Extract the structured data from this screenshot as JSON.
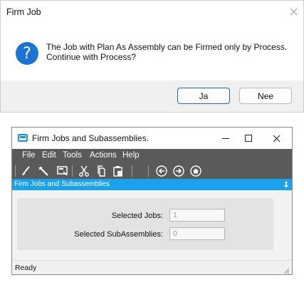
{
  "dialog": {
    "title": "Firm Job",
    "message_line1": "The Job with Plan As Assembly can be Firmed only by Process.",
    "message_line2": "Continue with Process?",
    "buttons": {
      "yes": "Ja",
      "no": "Nee"
    },
    "icon": "question-icon"
  },
  "window": {
    "title": "Firm Jobs and Subassemblies.",
    "menu": [
      "File",
      "Edit",
      "Tools",
      "Actions",
      "Help"
    ],
    "toolbar_icons": [
      "brush-icon",
      "magic-wand-icon",
      "screen-edit-icon",
      "cut-icon",
      "copy-icon",
      "paste-icon",
      "back-icon",
      "forward-icon",
      "home-icon"
    ],
    "panel_title": "Firm Jobs and Subassemblies",
    "form": {
      "selected_jobs_label": "Selected Jobs:",
      "selected_jobs_value": "1",
      "selected_subassemblies_label": "Selected SubAssemblies:",
      "selected_subassemblies_value": "0"
    },
    "status": "Ready"
  },
  "colors": {
    "accent": "#1aa2ec",
    "menubar": "#5a5a5a",
    "dialog_footer": "#f0f0f0",
    "question_icon": "#1d73d1"
  }
}
